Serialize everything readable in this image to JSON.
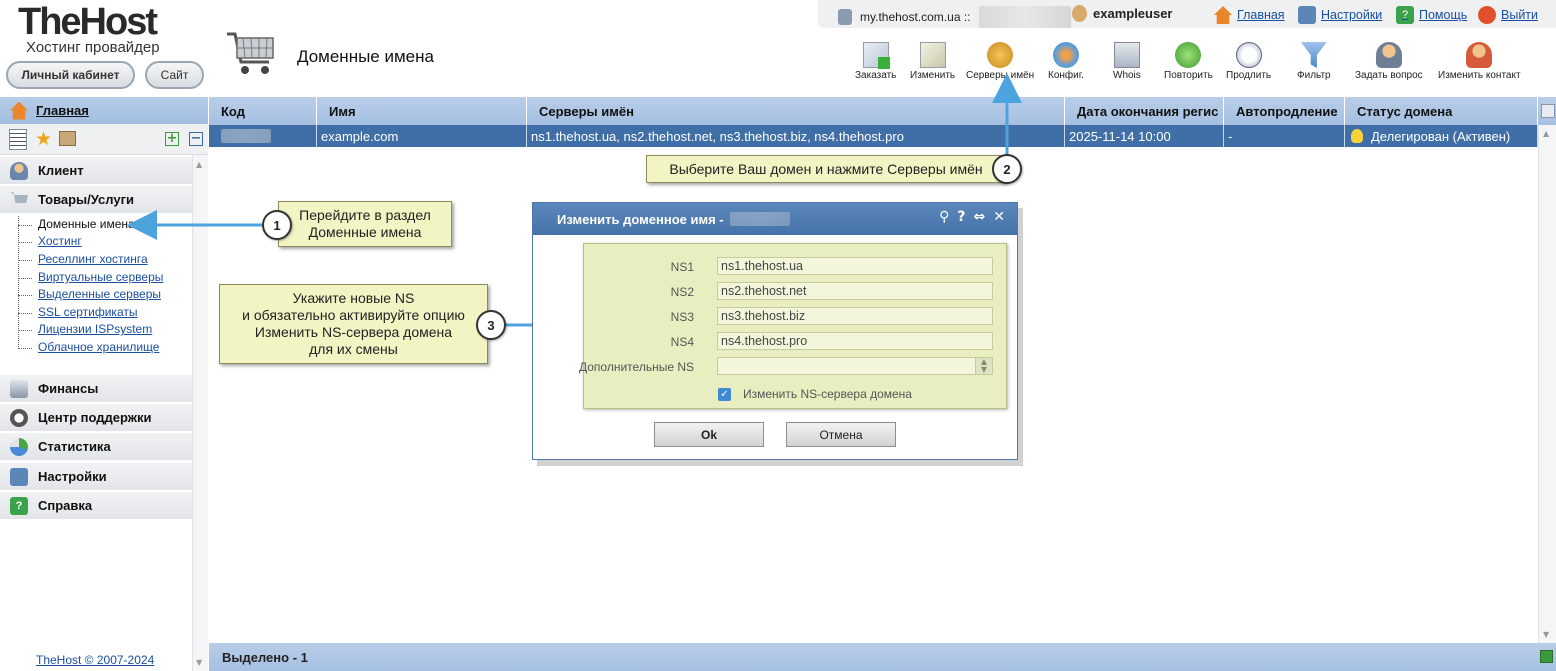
{
  "brand": {
    "name": "TheHost",
    "tagline": "Хостинг провайдер",
    "cabinet_label": "Личный кабинет",
    "site_label": "Сайт"
  },
  "page": {
    "title": "Доменные имена"
  },
  "topbar": {
    "server": "my.thehost.com.ua ::",
    "username": "exampleuser",
    "links": {
      "home": "Главная",
      "settings": "Настройки",
      "help": "Помощь",
      "logout": "Выйти"
    }
  },
  "toolbar": {
    "order": "Заказать",
    "edit": "Изменить",
    "nameservers": "Серверы имён",
    "config": "Конфиг.",
    "whois": "Whois",
    "repeat": "Повторить",
    "renew": "Продлить",
    "filter": "Фильтр",
    "ask": "Задать вопрос",
    "change_contact": "Изменить контакт"
  },
  "sidebar": {
    "home": "Главная",
    "client": "Клиент",
    "services": "Товары/Услуги",
    "items": [
      "Доменные имена",
      "Хостинг",
      "Реселлинг хостинга",
      "Виртуальные серверы",
      "Выделенные серверы",
      "SSL сертификаты",
      "Лицензии ISPsystem",
      "Облачное хранилище"
    ],
    "finance": "Финансы",
    "support": "Центр поддержки",
    "stats": "Статистика",
    "settings": "Настройки",
    "reference": "Справка",
    "copyright": "TheHost © 2007-2024"
  },
  "grid": {
    "headers": [
      "Код",
      "Имя",
      "Серверы имён",
      "Дата окончания регис",
      "Автопродление",
      "Статус домена"
    ],
    "row": {
      "name": "example.com",
      "ns": "ns1.thehost.ua, ns2.thehost.net, ns3.thehost.biz, ns4.thehost.pro",
      "expires": "2025-11-14 10:00",
      "autorenew": "-",
      "status": "Делегирован (Активен)"
    },
    "footer": "Выделено - 1"
  },
  "callouts": {
    "one_num": "1",
    "one_line1": "Перейдите в раздел",
    "one_line2": "Доменные имена",
    "two_num": "2",
    "two_text": "Выберите Ваш домен и нажмите Серверы имён",
    "three_num": "3",
    "three_line1": "Укажите новые NS",
    "three_line2": "и обязательно активируйте опцию",
    "three_line3": "Изменить NS-сервера домена",
    "three_line4": "для их смены"
  },
  "dialog": {
    "title": "Изменить доменное имя -",
    "labels": {
      "ns1": "NS1",
      "ns2": "NS2",
      "ns3": "NS3",
      "ns4": "NS4",
      "extra": "Дополнительные NS"
    },
    "values": {
      "ns1": "ns1.thehost.ua",
      "ns2": "ns2.thehost.net",
      "ns3": "ns3.thehost.biz",
      "ns4": "ns4.thehost.pro",
      "extra": ""
    },
    "checkbox_label": "Изменить NS-сервера домена",
    "checkbox_checked": true,
    "ok": "Ok",
    "cancel": "Отмена"
  },
  "colors": {
    "header_blue": "#a6c0e2",
    "row_selected": "#3f6fa6",
    "callout_bg": "#f2f4c4",
    "arrow": "#4da3de"
  }
}
